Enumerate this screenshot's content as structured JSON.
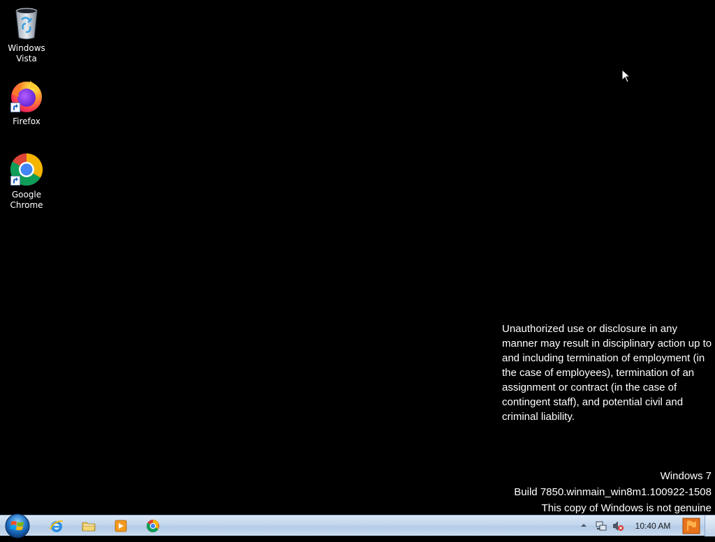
{
  "desktop": {
    "icons": [
      {
        "label": "Windows Vista",
        "icon": "recycle-bin-icon"
      },
      {
        "label": "Firefox",
        "icon": "firefox-icon"
      },
      {
        "label": "Google Chrome",
        "icon": "chrome-icon"
      }
    ],
    "notice": "Unauthorized use or disclosure in any manner may result in disciplinary action up to and including termination of employment (in the case of employees), termination of an assignment or contract (in the case of contingent staff), and potential civil and criminal liability.",
    "watermark": {
      "line1": "Windows 7",
      "line2": "Build 7850.winmain_win8m1.100922-1508",
      "line3": "This copy of Windows is not genuine"
    }
  },
  "taskbar": {
    "start_icon": "windows-start-icon",
    "pinned": [
      {
        "name": "internet-explorer",
        "icon": "ie-icon"
      },
      {
        "name": "windows-explorer",
        "icon": "folder-icon"
      },
      {
        "name": "media-player",
        "icon": "media-player-icon"
      },
      {
        "name": "google-chrome",
        "icon": "chrome-icon"
      }
    ],
    "tray": {
      "clock": "10:40 AM",
      "volume_state": "muted"
    }
  },
  "colors": {
    "desktop_bg": "#000000",
    "taskbar_bg": "#c2d6ed",
    "text": "#ffffff"
  }
}
